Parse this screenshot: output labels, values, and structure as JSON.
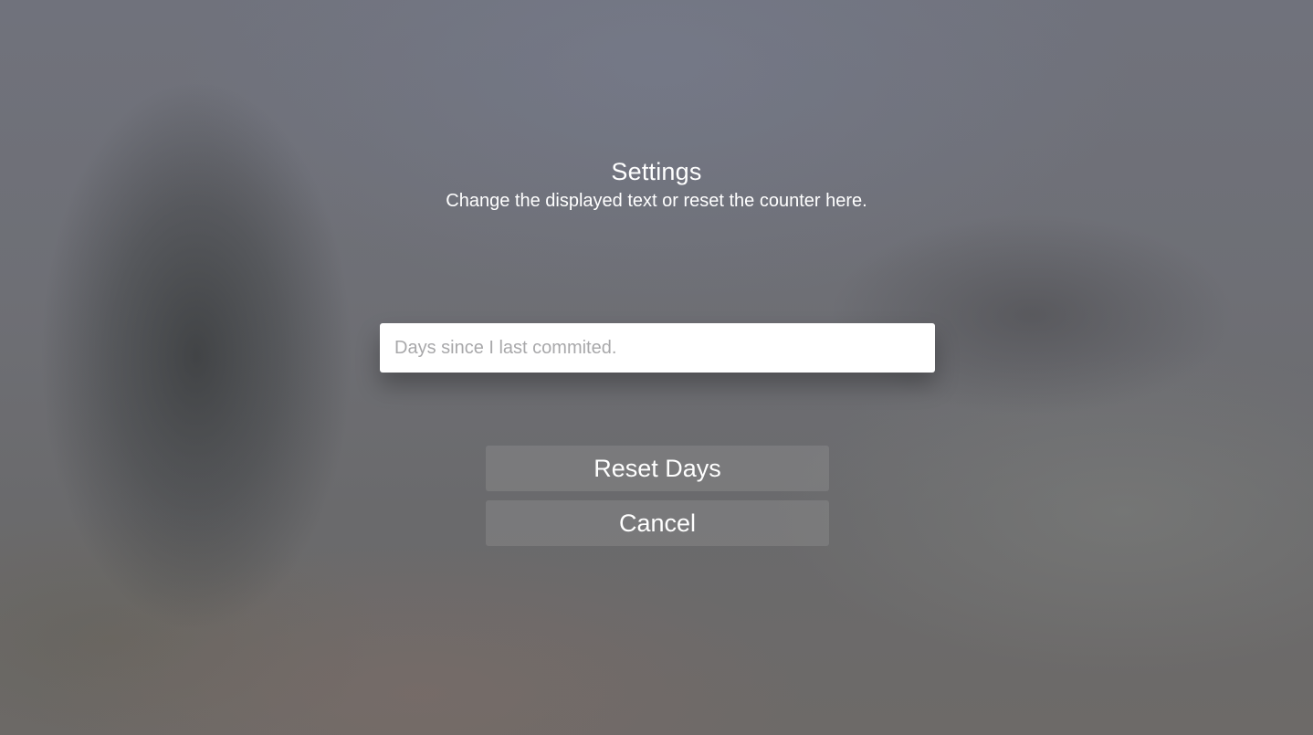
{
  "dialog": {
    "title": "Settings",
    "message": "Change the displayed text or reset the counter here."
  },
  "text_field": {
    "value": "",
    "placeholder": "Days since I last commited."
  },
  "actions": {
    "reset_label": "Reset Days",
    "cancel_label": "Cancel"
  },
  "colors": {
    "field_background": "#ffffff",
    "placeholder": "#a8a8aa",
    "text": "#ffffff"
  }
}
